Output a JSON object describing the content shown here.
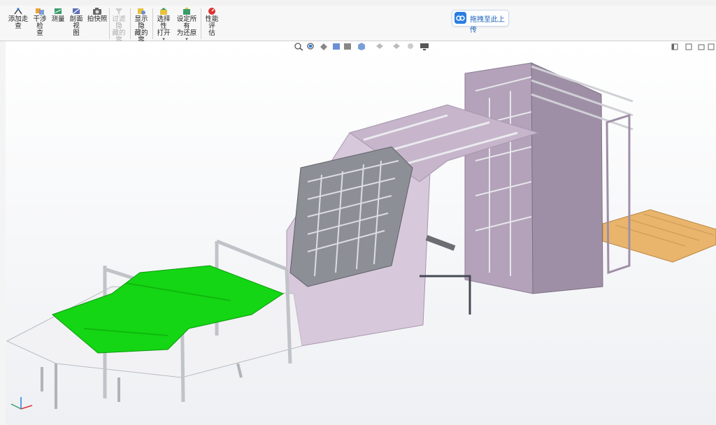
{
  "toolbar": {
    "tools": [
      {
        "id": "add-walkthrough",
        "label": "添加走\n查"
      },
      {
        "id": "interference",
        "label": "干涉检\n查"
      },
      {
        "id": "measure",
        "label": "测量"
      },
      {
        "id": "section",
        "label": "剖面视\n图"
      },
      {
        "id": "snapshot",
        "label": "拍快照"
      },
      {
        "id": "filter-hidden",
        "label": "过滤隐\n藏的零\n部件"
      },
      {
        "id": "show-hidden",
        "label": "显示隐\n藏的零\n部件"
      },
      {
        "id": "selective-open",
        "label": "选择性\n打开"
      },
      {
        "id": "restore-all",
        "label": "设定所有\n为还原"
      },
      {
        "id": "performance",
        "label": "性能评\n估"
      }
    ]
  },
  "upload": {
    "label": "拖拽至此上传"
  },
  "colors": {
    "frame": "#d8c8dc",
    "frameDark": "#b9a6be",
    "green": "#14d614",
    "wood": "#e9b46b",
    "metal": "#cfd2d6"
  }
}
